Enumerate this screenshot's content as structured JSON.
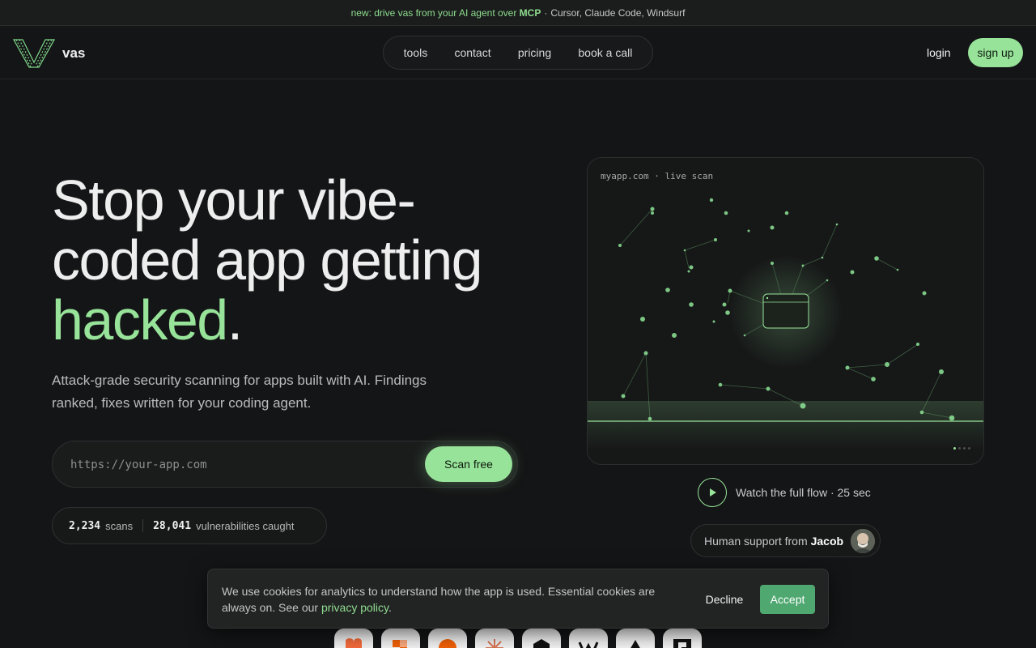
{
  "banner": {
    "highlight": "new: drive vas from your AI agent over",
    "mcp": "MCP",
    "sep": "·",
    "rest": "Cursor, Claude Code, Windsurf"
  },
  "nav": {
    "logo_text": "vas",
    "items": [
      "tools",
      "contact",
      "pricing",
      "book a call"
    ],
    "login": "login",
    "signup": "sign up"
  },
  "hero": {
    "title_line1": "Stop your vibe-",
    "title_line2": "coded app getting",
    "title_highlight": "hacked",
    "title_end": ".",
    "subtitle": "Attack-grade security scanning for apps built with AI. Findings ranked, fixes written for your coding agent.",
    "input_placeholder": "https://your-app.com",
    "scan_button": "Scan free"
  },
  "stats": {
    "scans_count": "2,234",
    "scans_label": "scans",
    "vulns_count": "28,041",
    "vulns_label": "vulnerabilities caught"
  },
  "scan_panel": {
    "label": "myapp.com · live scan",
    "active_slide": 1,
    "slide_count": 4
  },
  "watch": {
    "label": "Watch the full flow · 25 sec"
  },
  "support": {
    "prefix": "Human support from",
    "name": "Jacob"
  },
  "cookie": {
    "text": "We use cookies for analytics to understand how the app is used. Essential cookies are always on. See our",
    "link": "privacy policy",
    "end": ".",
    "decline": "Decline",
    "accept": "Accept"
  },
  "colors": {
    "accent": "#98e39a",
    "background": "#141516",
    "accept_button": "#4ea870"
  }
}
